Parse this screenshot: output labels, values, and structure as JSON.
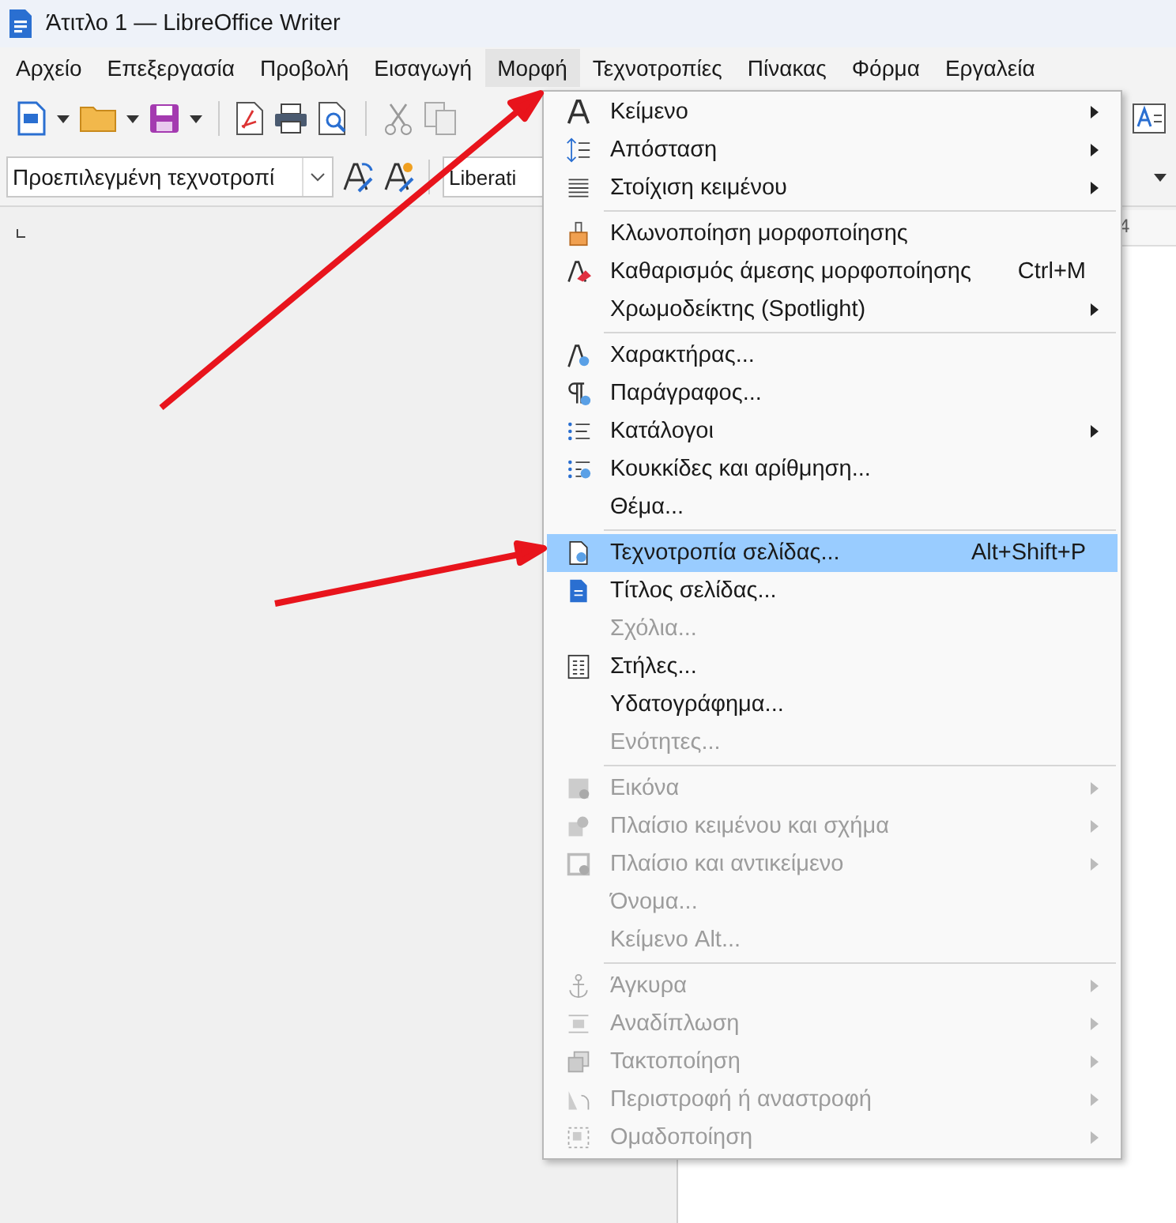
{
  "window": {
    "title": "Άτιτλο 1 — LibreOffice Writer"
  },
  "menubar": [
    {
      "label": "Αρχείο",
      "selected": false
    },
    {
      "label": "Επεξεργασία",
      "selected": false
    },
    {
      "label": "Προβολή",
      "selected": false
    },
    {
      "label": "Εισαγωγή",
      "selected": false
    },
    {
      "label": "Μορφή",
      "selected": true
    },
    {
      "label": "Τεχνοτροπίες",
      "selected": false
    },
    {
      "label": "Πίνακας",
      "selected": false
    },
    {
      "label": "Φόρμα",
      "selected": false
    },
    {
      "label": "Εργαλεία",
      "selected": false
    }
  ],
  "formatting_bar": {
    "paragraph_style": "Προεπιλεγμένη τεχνοτροπί",
    "font_name": "Liberati"
  },
  "ruler": {
    "number": "4"
  },
  "menu": [
    {
      "kind": "item",
      "label": "Κείμενο",
      "submenu": true,
      "disabled": false,
      "selected": false
    },
    {
      "kind": "item",
      "label": "Απόσταση",
      "submenu": true,
      "disabled": false,
      "selected": false
    },
    {
      "kind": "item",
      "label": "Στοίχιση κειμένου",
      "submenu": true,
      "disabled": false,
      "selected": false
    },
    {
      "kind": "separator"
    },
    {
      "kind": "item",
      "label": "Κλωνοποίηση μορφοποίησης",
      "submenu": false,
      "disabled": false,
      "selected": false
    },
    {
      "kind": "item",
      "label": "Καθαρισμός άμεσης μορφοποίησης",
      "shortcut": "Ctrl+M",
      "submenu": false,
      "disabled": false,
      "selected": false
    },
    {
      "kind": "item",
      "label": "Χρωμοδείκτης (Spotlight)",
      "submenu": true,
      "disabled": false,
      "selected": false
    },
    {
      "kind": "separator"
    },
    {
      "kind": "item",
      "label": "Χαρακτήρας...",
      "submenu": false,
      "disabled": false,
      "selected": false
    },
    {
      "kind": "item",
      "label": "Παράγραφος...",
      "submenu": false,
      "disabled": false,
      "selected": false
    },
    {
      "kind": "item",
      "label": "Κατάλογοι",
      "submenu": true,
      "disabled": false,
      "selected": false
    },
    {
      "kind": "item",
      "label": "Κουκκίδες και αρίθμηση...",
      "submenu": false,
      "disabled": false,
      "selected": false
    },
    {
      "kind": "item",
      "label": "Θέμα...",
      "submenu": false,
      "disabled": false,
      "selected": false
    },
    {
      "kind": "separator"
    },
    {
      "kind": "item",
      "label": "Τεχνοτροπία σελίδας...",
      "shortcut": "Alt+Shift+P",
      "submenu": false,
      "disabled": false,
      "selected": true
    },
    {
      "kind": "item",
      "label": "Τίτλος σελίδας...",
      "submenu": false,
      "disabled": false,
      "selected": false
    },
    {
      "kind": "item",
      "label": "Σχόλια...",
      "submenu": false,
      "disabled": true,
      "selected": false
    },
    {
      "kind": "item",
      "label": "Στήλες...",
      "submenu": false,
      "disabled": false,
      "selected": false
    },
    {
      "kind": "item",
      "label": "Υδατογράφημα...",
      "submenu": false,
      "disabled": false,
      "selected": false
    },
    {
      "kind": "item",
      "label": "Ενότητες...",
      "submenu": false,
      "disabled": true,
      "selected": false
    },
    {
      "kind": "separator"
    },
    {
      "kind": "item",
      "label": "Εικόνα",
      "submenu": true,
      "disabled": true,
      "selected": false
    },
    {
      "kind": "item",
      "label": "Πλαίσιο κειμένου και σχήμα",
      "submenu": true,
      "disabled": true,
      "selected": false
    },
    {
      "kind": "item",
      "label": "Πλαίσιο και αντικείμενο",
      "submenu": true,
      "disabled": true,
      "selected": false
    },
    {
      "kind": "item",
      "label": "Όνομα...",
      "submenu": false,
      "disabled": true,
      "selected": false
    },
    {
      "kind": "item",
      "label": "Κείμενο Alt...",
      "submenu": false,
      "disabled": true,
      "selected": false
    },
    {
      "kind": "separator"
    },
    {
      "kind": "item",
      "label": "Άγκυρα",
      "submenu": true,
      "disabled": true,
      "selected": false
    },
    {
      "kind": "item",
      "label": "Αναδίπλωση",
      "submenu": true,
      "disabled": true,
      "selected": false
    },
    {
      "kind": "item",
      "label": "Τακτοποίηση",
      "submenu": true,
      "disabled": true,
      "selected": false
    },
    {
      "kind": "item",
      "label": "Περιστροφή ή αναστροφή",
      "submenu": true,
      "disabled": true,
      "selected": false
    },
    {
      "kind": "item",
      "label": "Ομαδοποίηση",
      "submenu": true,
      "disabled": true,
      "selected": false
    }
  ]
}
